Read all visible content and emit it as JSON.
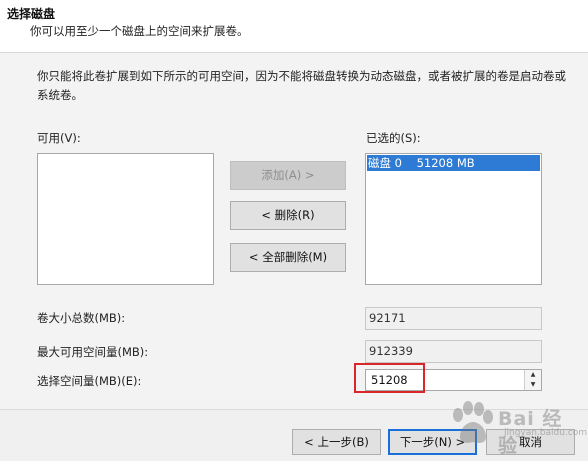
{
  "header": {
    "title": "选择磁盘",
    "subtitle": "你可以用至少一个磁盘上的空间来扩展卷。"
  },
  "description": "你只能将此卷扩展到如下所示的可用空间，因为不能将磁盘转换为动态磁盘，或者被扩展的卷是启动卷或系统卷。",
  "available": {
    "label": "可用(V):",
    "items": []
  },
  "selected": {
    "label": "已选的(S):",
    "items": [
      {
        "text": "磁盘 0    51208 MB"
      }
    ]
  },
  "buttons": {
    "add": "添加(A) >",
    "remove": "< 删除(R)",
    "remove_all": "< 全部删除(M)"
  },
  "fields": {
    "total_label": "卷大小总数(MB):",
    "total_value": "92171",
    "max_label": "最大可用空间量(MB):",
    "max_value": "912339",
    "select_label": "选择空间量(MB)(E):",
    "select_value": "51208"
  },
  "footer": {
    "back": "< 上一步(B)",
    "next": "下一步(N) >",
    "cancel": "取消"
  },
  "watermark": {
    "text": "Bai 经验",
    "sub": "jingyan.baidu.com"
  },
  "colors": {
    "selection": "#2e7bd6",
    "highlight": "#d8262a",
    "default_border": "#1a6fd8"
  }
}
